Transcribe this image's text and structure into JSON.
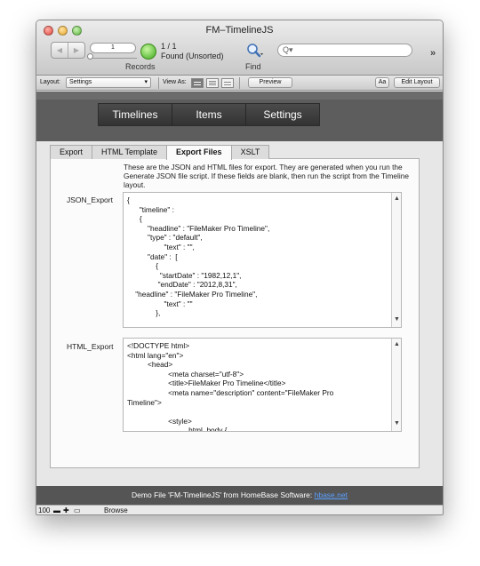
{
  "window": {
    "title": "FM–TimelineJS"
  },
  "toolbar": {
    "record_number": "1",
    "found_count": "1 / 1",
    "found_status": "Found (Unsorted)",
    "records_label": "Records",
    "find_label": "Find",
    "search_placeholder": "Q▾",
    "overflow": "»"
  },
  "layoutbar": {
    "layout_label": "Layout:",
    "layout_value": "Settings",
    "view_as_label": "View As:",
    "preview_label": "Preview",
    "aa_label": "Aa",
    "edit_layout_label": "Edit Layout"
  },
  "nav": {
    "tabs": [
      {
        "label": "Timelines"
      },
      {
        "label": "Items"
      },
      {
        "label": "Settings"
      }
    ]
  },
  "subtabs": [
    {
      "label": "Export"
    },
    {
      "label": "HTML Template"
    },
    {
      "label": "Export Files"
    },
    {
      "label": "XSLT"
    }
  ],
  "content": {
    "intro": "These are the JSON and HTML files for export. They are generated when you run the Generate JSON file script. If these fields are blank, then run the script from the Timeline layout.",
    "json_label": "JSON_Export",
    "json_value": "{\n      \"timeline\" :\n      {\n          \"headline\" : \"FileMaker Pro Timeline\",\n          \"type\" : \"default\",\n                  \"text\" : \"\",\n          \"date\" :  [\n              {\n                \"startDate\" : \"1982,12,1\",\n               \"endDate\" : \"2012,8,31\",\n    \"headline\" : \"FileMaker Pro Timeline\",\n                  \"text\" : \"\"\n              },\n",
    "html_label": "HTML_Export",
    "html_value": "<!DOCTYPE html>\n<html lang=\"en\">\n          <head>\n                    <meta charset=\"utf-8\">\n                    <title>FileMaker Pro Timeline</title>\n                    <meta name=\"description\" content=\"FileMaker Pro\nTimeline\">\n\n                    <style>\n                              html, body {"
  },
  "footer": {
    "text": "Demo File 'FM-TimelineJS' from HomeBase Software: ",
    "link": "hbase.net"
  },
  "statusbar": {
    "zoom": "100",
    "mode": "Browse"
  }
}
